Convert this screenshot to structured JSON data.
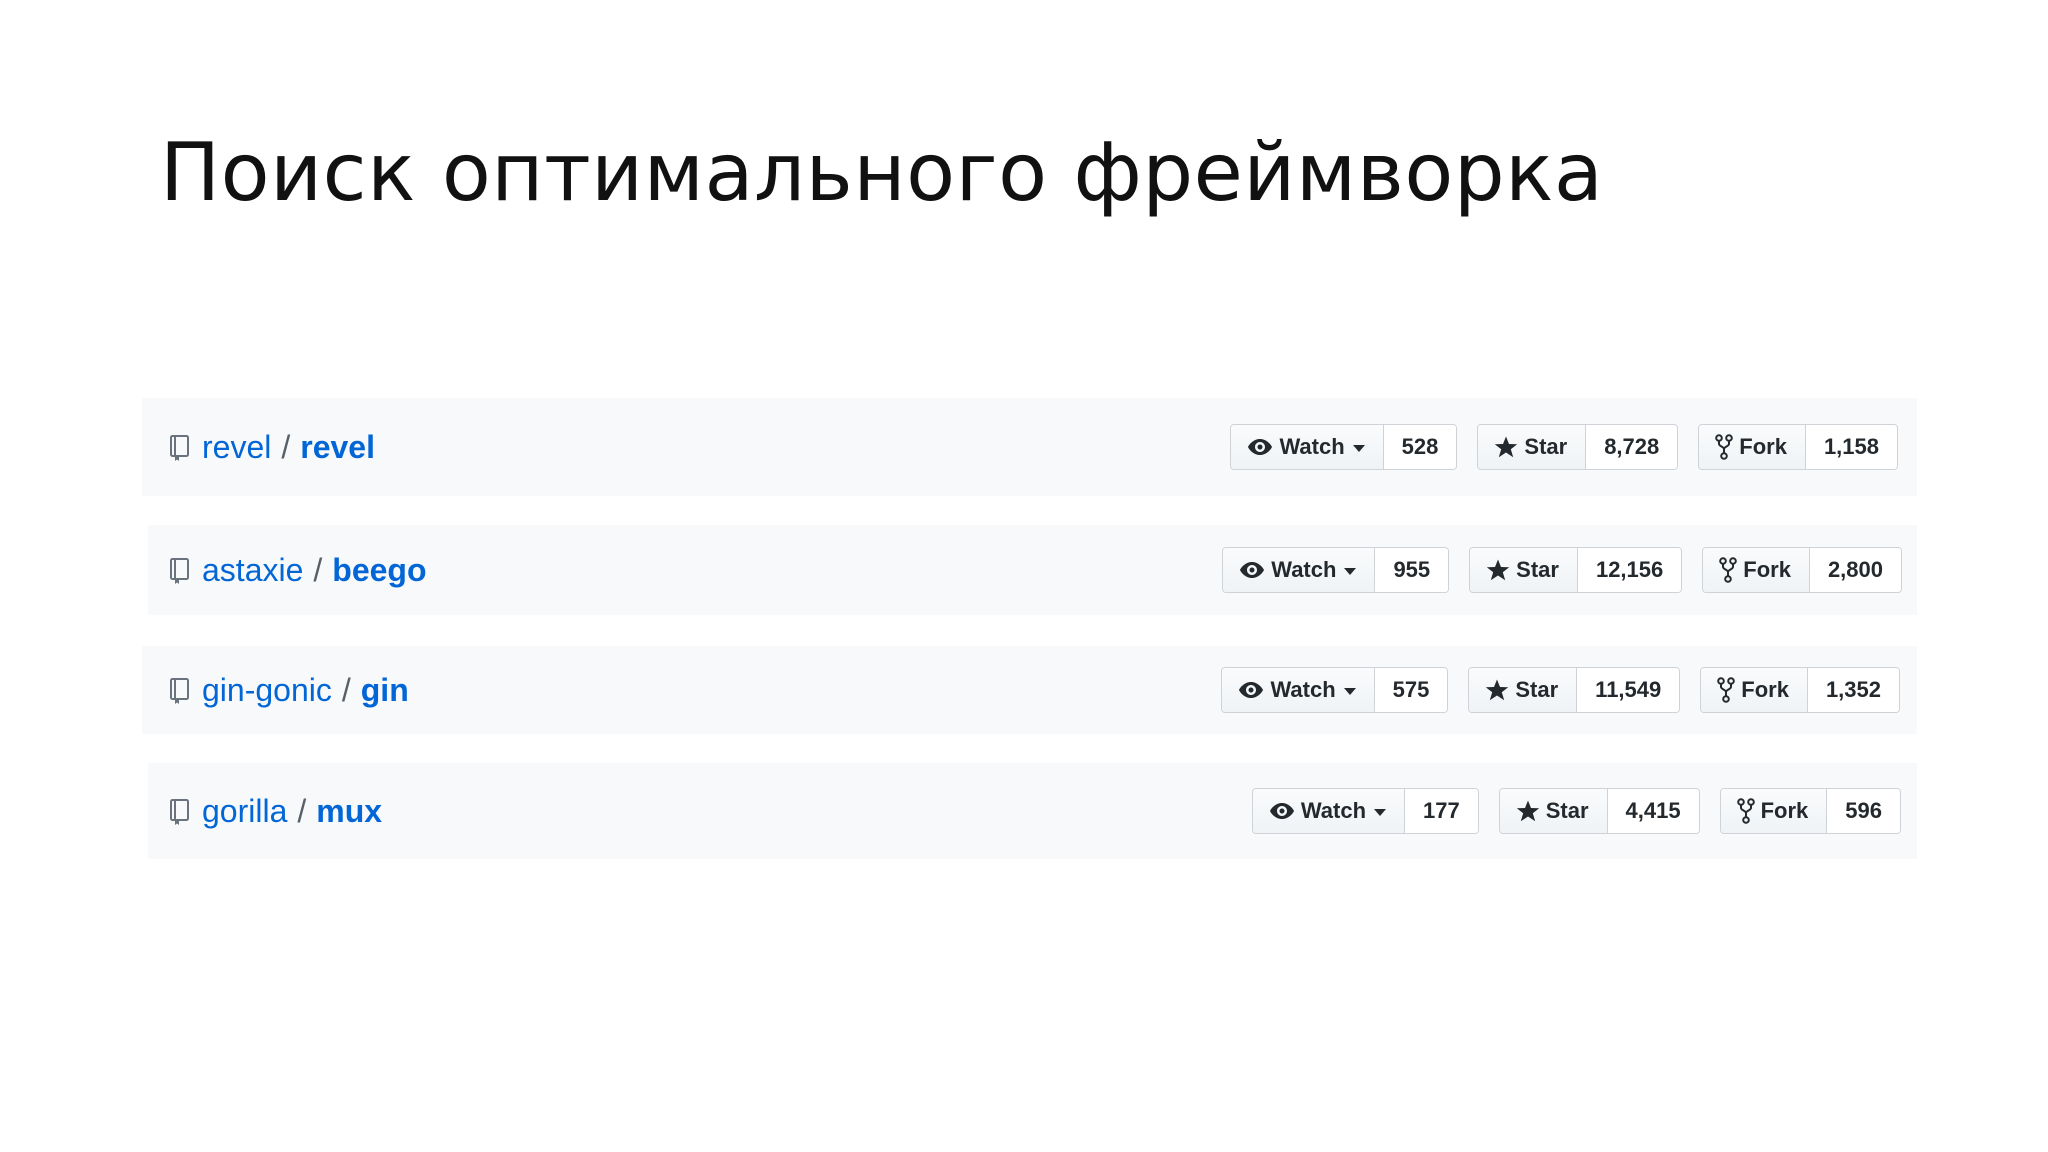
{
  "slide": {
    "title": "Поиск оптимального фреймворка"
  },
  "repos": [
    {
      "owner": "revel",
      "name": "revel",
      "watch_label": "Watch",
      "watch_count": "528",
      "star_label": "Star",
      "star_count": "8,728",
      "fork_label": "Fork",
      "fork_count": "1,158"
    },
    {
      "owner": "astaxie",
      "name": "beego",
      "watch_label": "Watch",
      "watch_count": "955",
      "star_label": "Star",
      "star_count": "12,156",
      "fork_label": "Fork",
      "fork_count": "2,800"
    },
    {
      "owner": "gin-gonic",
      "name": "gin",
      "watch_label": "Watch",
      "watch_count": "575",
      "star_label": "Star",
      "star_count": "11,549",
      "fork_label": "Fork",
      "fork_count": "1,352"
    },
    {
      "owner": "gorilla",
      "name": "mux",
      "watch_label": "Watch",
      "watch_count": "177",
      "star_label": "Star",
      "star_count": "4,415",
      "fork_label": "Fork",
      "fork_count": "596"
    }
  ],
  "separator": "/",
  "colors": {
    "link": "#0366d6",
    "text": "#24292e",
    "row_background": "#f8f9fa",
    "border": "#cfd3d7"
  },
  "icons": [
    "repo-icon",
    "eye-icon",
    "chevron-down-icon",
    "star-icon",
    "fork-icon"
  ]
}
